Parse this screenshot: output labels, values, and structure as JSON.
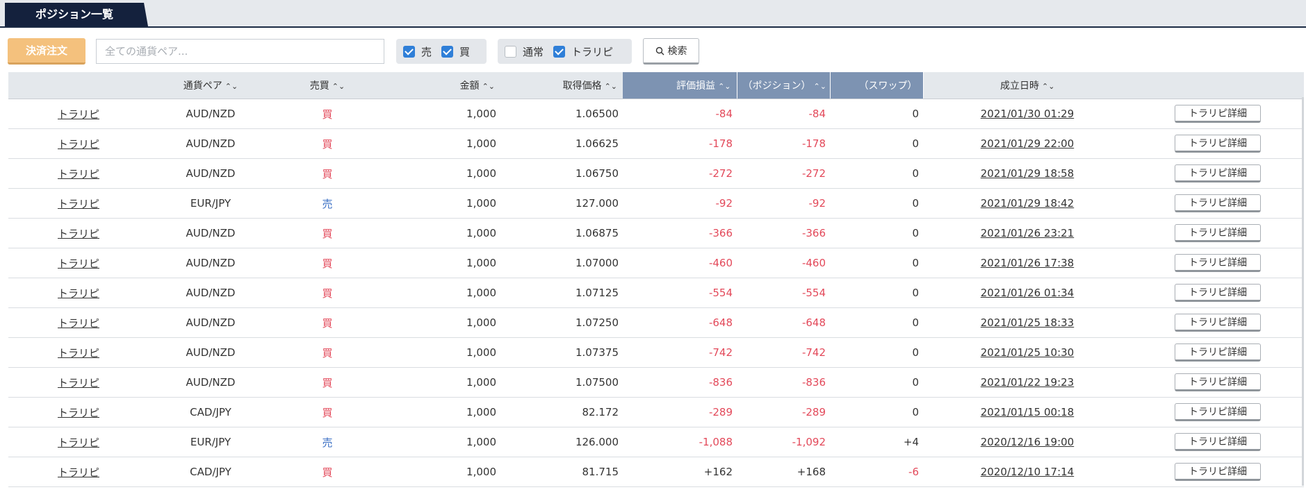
{
  "tab": {
    "label": "ポジション一覧"
  },
  "toolbar": {
    "settle_label": "決済注文",
    "search_placeholder": "全ての通貨ペア...",
    "filters": {
      "sell": {
        "label": "売",
        "checked": true
      },
      "buy": {
        "label": "買",
        "checked": true
      },
      "normal": {
        "label": "通常",
        "checked": false
      },
      "trarepi": {
        "label": "トラリピ",
        "checked": true
      }
    },
    "search_label": "検索"
  },
  "columns": {
    "pair": "通貨ペア",
    "side": "売買",
    "amount": "金額",
    "price": "取得価格",
    "pl": "評価損益",
    "pos": "（ポジション）",
    "swap": "（スワップ）",
    "date": "成立日時"
  },
  "detail_label": "トラリピ詳細",
  "colors": {
    "negative": "#e3495a",
    "buy": "#e3495a",
    "sell": "#3a6fc4",
    "header_highlight": "#7d93b2",
    "tab": "#14213d",
    "settle_button": "#f4c17d"
  },
  "rows": [
    {
      "type": "トラリピ",
      "pair": "AUD/NZD",
      "side": "買",
      "amount": "1,000",
      "price": "1.06500",
      "pl": "-84",
      "pos": "-84",
      "swap": "0",
      "date": "2021/01/30 01:29"
    },
    {
      "type": "トラリピ",
      "pair": "AUD/NZD",
      "side": "買",
      "amount": "1,000",
      "price": "1.06625",
      "pl": "-178",
      "pos": "-178",
      "swap": "0",
      "date": "2021/01/29 22:00"
    },
    {
      "type": "トラリピ",
      "pair": "AUD/NZD",
      "side": "買",
      "amount": "1,000",
      "price": "1.06750",
      "pl": "-272",
      "pos": "-272",
      "swap": "0",
      "date": "2021/01/29 18:58"
    },
    {
      "type": "トラリピ",
      "pair": "EUR/JPY",
      "side": "売",
      "amount": "1,000",
      "price": "127.000",
      "pl": "-92",
      "pos": "-92",
      "swap": "0",
      "date": "2021/01/29 18:42"
    },
    {
      "type": "トラリピ",
      "pair": "AUD/NZD",
      "side": "買",
      "amount": "1,000",
      "price": "1.06875",
      "pl": "-366",
      "pos": "-366",
      "swap": "0",
      "date": "2021/01/26 23:21"
    },
    {
      "type": "トラリピ",
      "pair": "AUD/NZD",
      "side": "買",
      "amount": "1,000",
      "price": "1.07000",
      "pl": "-460",
      "pos": "-460",
      "swap": "0",
      "date": "2021/01/26 17:38"
    },
    {
      "type": "トラリピ",
      "pair": "AUD/NZD",
      "side": "買",
      "amount": "1,000",
      "price": "1.07125",
      "pl": "-554",
      "pos": "-554",
      "swap": "0",
      "date": "2021/01/26 01:34"
    },
    {
      "type": "トラリピ",
      "pair": "AUD/NZD",
      "side": "買",
      "amount": "1,000",
      "price": "1.07250",
      "pl": "-648",
      "pos": "-648",
      "swap": "0",
      "date": "2021/01/25 18:33"
    },
    {
      "type": "トラリピ",
      "pair": "AUD/NZD",
      "side": "買",
      "amount": "1,000",
      "price": "1.07375",
      "pl": "-742",
      "pos": "-742",
      "swap": "0",
      "date": "2021/01/25 10:30"
    },
    {
      "type": "トラリピ",
      "pair": "AUD/NZD",
      "side": "買",
      "amount": "1,000",
      "price": "1.07500",
      "pl": "-836",
      "pos": "-836",
      "swap": "0",
      "date": "2021/01/22 19:23"
    },
    {
      "type": "トラリピ",
      "pair": "CAD/JPY",
      "side": "買",
      "amount": "1,000",
      "price": "82.172",
      "pl": "-289",
      "pos": "-289",
      "swap": "0",
      "date": "2021/01/15 00:18"
    },
    {
      "type": "トラリピ",
      "pair": "EUR/JPY",
      "side": "売",
      "amount": "1,000",
      "price": "126.000",
      "pl": "-1,088",
      "pos": "-1,092",
      "swap": "+4",
      "date": "2020/12/16 19:00"
    },
    {
      "type": "トラリピ",
      "pair": "CAD/JPY",
      "side": "買",
      "amount": "1,000",
      "price": "81.715",
      "pl": "+162",
      "pos": "+168",
      "swap": "-6",
      "date": "2020/12/10 17:14"
    }
  ]
}
